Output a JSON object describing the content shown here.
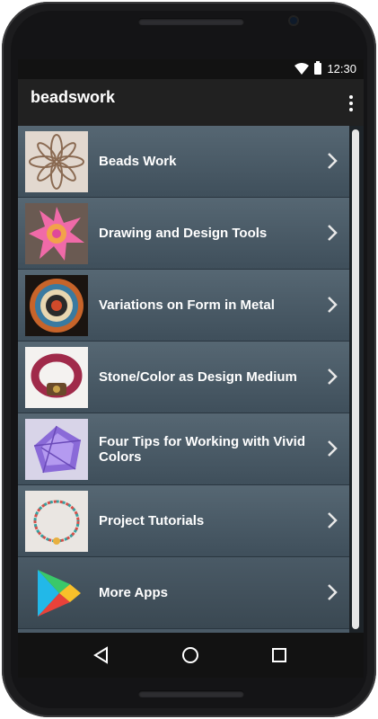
{
  "status_bar": {
    "time": "12:30"
  },
  "app_bar": {
    "title": "beadswork"
  },
  "items": [
    {
      "label": "Beads Work"
    },
    {
      "label": "Drawing and Design Tools"
    },
    {
      "label": "Variations on Form in Metal"
    },
    {
      "label": "Stone/Color as Design Medium"
    },
    {
      "label": "Four Tips for Working with Vivid Colors"
    },
    {
      "label": "Project Tutorials"
    },
    {
      "label": "More Apps"
    }
  ],
  "colors": {
    "list_background": "#4a5a66",
    "app_bar": "#212121",
    "status_bar": "#121212"
  }
}
